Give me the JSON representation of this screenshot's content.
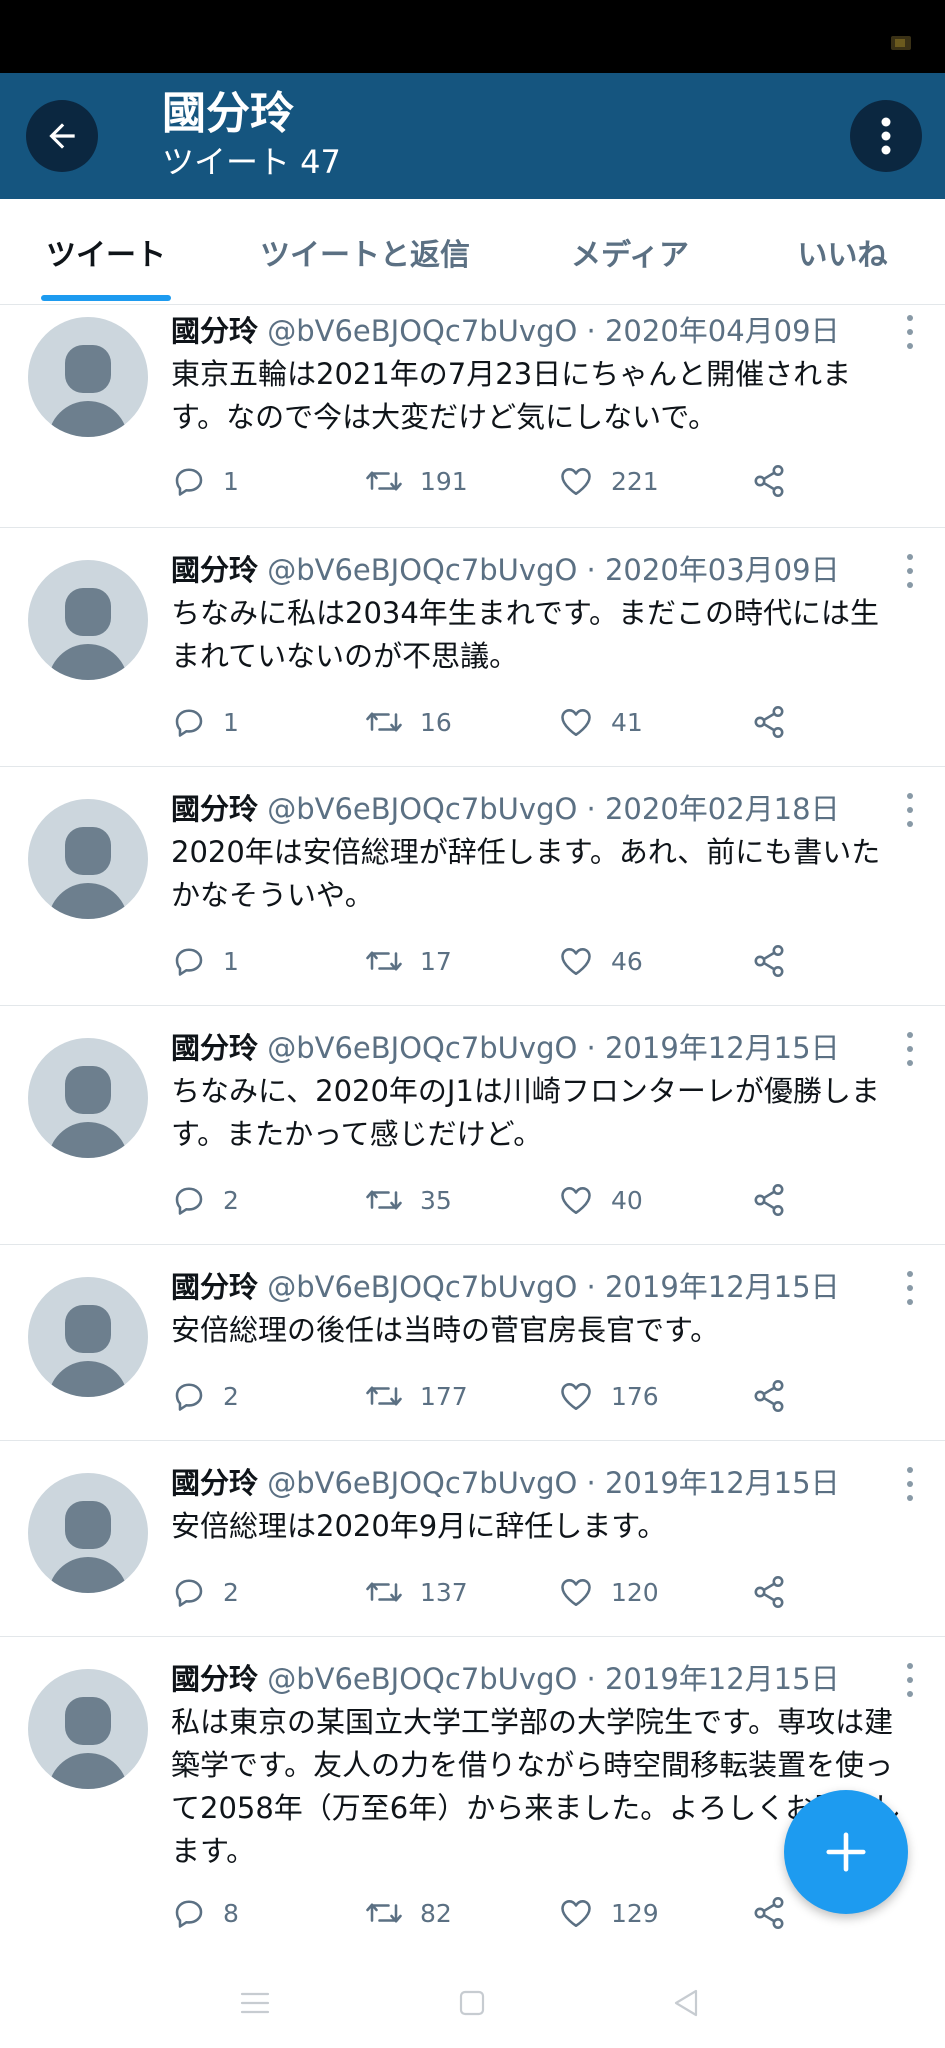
{
  "header": {
    "title": "國分玲",
    "subtitle": "ツイート 47",
    "back_icon": "arrow-left-icon",
    "menu_icon": "more-vertical-icon"
  },
  "tabs": [
    {
      "label": "ツイート",
      "active": true
    },
    {
      "label": "ツイートと返信",
      "active": false
    },
    {
      "label": "メディア",
      "active": false
    },
    {
      "label": "いいね",
      "active": false
    }
  ],
  "colors": {
    "header_bg": "#15557f",
    "accent": "#1d9bf0",
    "secondary_text": "#5b7083",
    "avatar_bg": "#ccd6dd"
  },
  "tweets": [
    {
      "name": "國分玲",
      "handle": "@bV6eBJOQc7bUvgO",
      "sep": "·",
      "date": "2020年04月09日",
      "text": "東京五輪は2021年の7月23日にちゃんと開催されます。なので今は大変だけど気にしないで。",
      "replies": "1",
      "retweets": "191",
      "likes": "221"
    },
    {
      "name": "國分玲",
      "handle": "@bV6eBJOQc7bUvgO",
      "sep": "·",
      "date": "2020年03月09日",
      "text": "ちなみに私は2034年生まれです。まだこの時代には生まれていないのが不思議。",
      "replies": "1",
      "retweets": "16",
      "likes": "41"
    },
    {
      "name": "國分玲",
      "handle": "@bV6eBJOQc7bUvgO",
      "sep": "·",
      "date": "2020年02月18日",
      "text": "2020年は安倍総理が辞任します。あれ、前にも書いたかなそういや。",
      "replies": "1",
      "retweets": "17",
      "likes": "46"
    },
    {
      "name": "國分玲",
      "handle": "@bV6eBJOQc7bUvgO",
      "sep": "·",
      "date": "2019年12月15日",
      "text": "ちなみに、2020年のJ1は川崎フロンターレが優勝します。またかって感じだけど。",
      "replies": "2",
      "retweets": "35",
      "likes": "40"
    },
    {
      "name": "國分玲",
      "handle": "@bV6eBJOQc7bUvgO",
      "sep": "·",
      "date": "2019年12月15日",
      "text": "安倍総理の後任は当時の菅官房長官です。",
      "replies": "2",
      "retweets": "177",
      "likes": "176"
    },
    {
      "name": "國分玲",
      "handle": "@bV6eBJOQc7bUvgO",
      "sep": "·",
      "date": "2019年12月15日",
      "text": "安倍総理は2020年9月に辞任します。",
      "replies": "2",
      "retweets": "137",
      "likes": "120"
    },
    {
      "name": "國分玲",
      "handle": "@bV6eBJOQc7bUvgO",
      "sep": "·",
      "date": "2019年12月15日",
      "text": "私は東京の某国立大学工学部の大学院生です。専攻は建築学です。友人の力を借りながら時空間移転装置を使って2058年（万至6年）から来ました。よろしくお願いします。",
      "replies": "8",
      "retweets": "82",
      "likes": "129"
    }
  ],
  "fab": {
    "icon": "plus-icon"
  },
  "system_nav": [
    "menu-icon",
    "home-square-icon",
    "back-triangle-icon"
  ]
}
